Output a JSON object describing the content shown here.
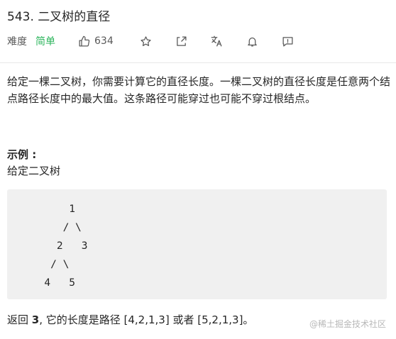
{
  "problem": {
    "title": "543. 二叉树的直径",
    "difficulty_label": "难度",
    "difficulty": "简单",
    "likes": "634"
  },
  "toolbar": {
    "icons": [
      "thumbs-up-icon",
      "star-icon",
      "share-icon",
      "translate-icon",
      "bell-icon",
      "feedback-icon"
    ]
  },
  "description": {
    "text": "给定一棵二叉树，你需要计算它的直径长度。一棵二叉树的直径长度是任意两个结点路径长度中的最大值。这条路径可能穿过也可能不穿过根结点。"
  },
  "example": {
    "title": "示例 :",
    "subtitle": "给定二叉树",
    "code": "          1\n         / \\\n        2   3\n       / \\\n      4   5",
    "result_prefix": "返回 ",
    "result_value": "3",
    "result_suffix": ", 它的长度是路径 [4,2,1,3] 或者 [5,2,1,3]。"
  },
  "watermark": "@稀土掘金技术社区",
  "colors": {
    "difficulty_easy": "#2db55d",
    "code_bg": "#f0f0f0",
    "text": "#262626"
  }
}
